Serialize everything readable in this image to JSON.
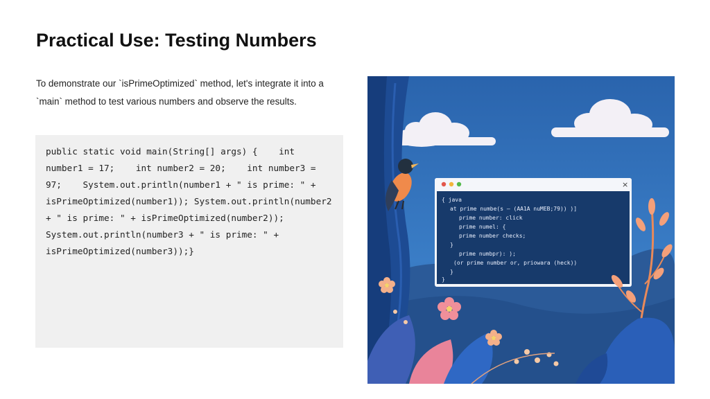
{
  "slide": {
    "title": "Practical Use: Testing Numbers",
    "intro": "To demonstrate our `isPrimeOptimized` method, let's integrate it into a `main` method to test various numbers and observe the results.",
    "code": "public static void main(String[] args) {    int number1 = 17;    int number2 = 20;    int number3 = 97;    System.out.println(number1 + \" is prime: \" + isPrimeOptimized(number1)); System.out.println(number2 + \" is prime: \" + isPrimeOptimized(number2)); System.out.println(number3 + \" is prime: \" + isPrimeOptimized(number3));}"
  },
  "illustration": {
    "window_close_glyph": "×",
    "window_code_lines": [
      "{  java",
      "at prime numbe(s – (AA1A nuMEB;79))  )]",
      "prime number: click",
      "prime numel: {",
      "prime number checks;",
      "}",
      "prime numbpr): );",
      "(or prime number or, priowara (heck))",
      "}",
      "}"
    ],
    "colors": {
      "sky": "#2f6fb8",
      "window_body": "#173a6b",
      "flower": "#f4a07a",
      "leaf": "#2a4f9a"
    }
  }
}
